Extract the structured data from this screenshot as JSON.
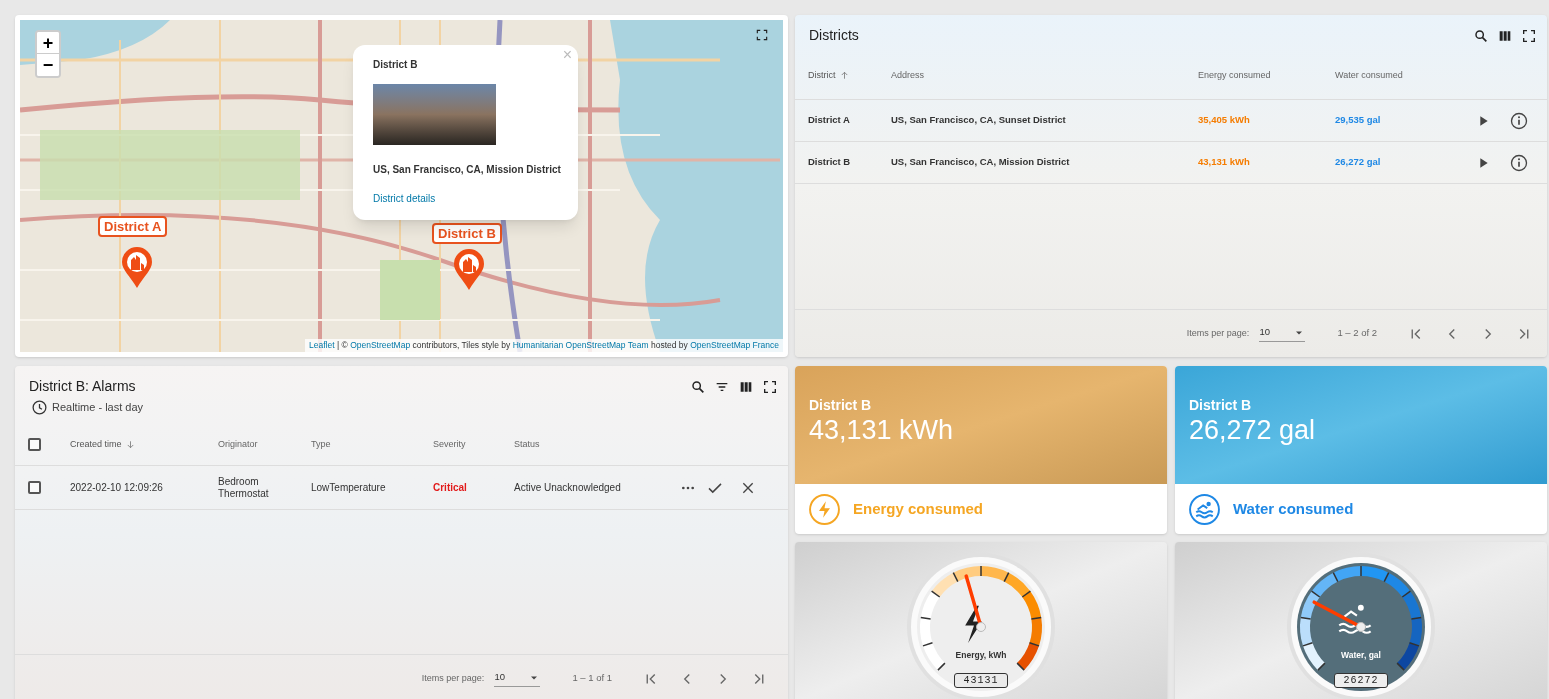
{
  "map": {
    "zoom_in": "+",
    "zoom_out": "−",
    "markers": [
      {
        "label": "District A"
      },
      {
        "label": "District B"
      }
    ],
    "popup": {
      "title": "District B",
      "close": "×",
      "address": "US, San Francisco, CA, Mission District",
      "link": "District details"
    },
    "attribution": [
      {
        "text": "Leaflet",
        "link": true
      },
      {
        "text": " | © ",
        "link": false
      },
      {
        "text": "OpenStreetMap",
        "link": true
      },
      {
        "text": " contributors, Tiles style by ",
        "link": false
      },
      {
        "text": "Humanitarian OpenStreetMap Team",
        "link": true
      },
      {
        "text": " hosted by ",
        "link": false
      },
      {
        "text": "OpenStreetMap France",
        "link": true
      }
    ]
  },
  "districts": {
    "title": "Districts",
    "columns": [
      {
        "label": "District",
        "sorted": true,
        "descending": false
      },
      {
        "label": "Address",
        "sorted": false
      },
      {
        "label": "Energy consumed",
        "sorted": false
      },
      {
        "label": "Water consumed",
        "sorted": false
      }
    ],
    "rows": [
      {
        "cells": [
          "District A",
          "US, San Francisco, CA, Sunset District",
          "35,405 kWh",
          "29,535 gal"
        ]
      },
      {
        "cells": [
          "District B",
          "US, San Francisco, CA, Mission District",
          "43,131 kWh",
          "26,272 gal"
        ]
      }
    ],
    "pagination": {
      "label": "Items per page:",
      "page_size": "10",
      "range": "1 – 2 of 2"
    }
  },
  "alarms": {
    "title": "District B: Alarms",
    "timewindow": "Realtime - last day",
    "select_all": {
      "checked": false
    },
    "columns": [
      {
        "label": "Created time",
        "sorted": true,
        "descending": true
      },
      {
        "label": "Originator",
        "sorted": false
      },
      {
        "label": "Type",
        "sorted": false
      },
      {
        "label": "Severity",
        "sorted": false
      },
      {
        "label": "Status",
        "sorted": false
      }
    ],
    "rows": [
      {
        "checked": false,
        "cells": [
          "2022-02-10 12:09:26",
          "Bedroom Thermostat",
          "LowTemperature",
          "Critical",
          "Active Unacknowledged"
        ]
      }
    ],
    "pagination": {
      "label": "Items per page:",
      "page_size": "10",
      "range": "1 – 1 of 1"
    }
  },
  "value_cards": [
    {
      "kind": "energy",
      "title": "District B",
      "value": "43,131 kWh",
      "label": "Energy consumed"
    },
    {
      "kind": "water",
      "title": "District B",
      "value": "26,272 gal",
      "label": "Water consumed"
    }
  ],
  "gauges": [
    {
      "kind": "energy",
      "label": "Energy, kWh",
      "readout": "43131",
      "level": 0.44
    },
    {
      "kind": "water",
      "label": "Water, gal",
      "readout": "26272",
      "level": 0.27
    }
  ]
}
